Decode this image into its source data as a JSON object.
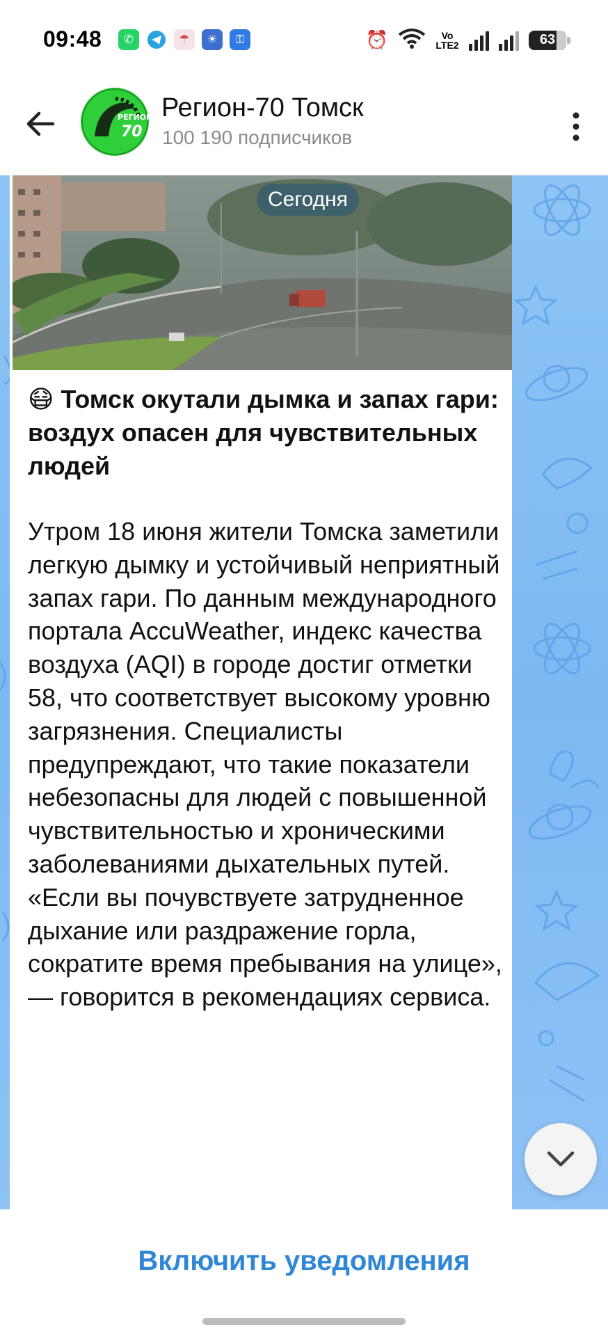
{
  "status_bar": {
    "time": "09:48",
    "app_icons": [
      "whatsapp-icon",
      "telegram-icon",
      "umbrella-icon",
      "weather-icon",
      "key-icon"
    ],
    "network": "Vo LTE2",
    "battery": "63"
  },
  "header": {
    "channel_name": "Регион-70 Томск",
    "subscribers": "100 190 подписчиков",
    "avatar_text_top": "РЕГИОН",
    "avatar_text_bottom": "70"
  },
  "chat": {
    "date_label": "Сегодня",
    "post": {
      "emoji": "😷",
      "title": "Томск окутали дымка и запах гари: воздух опасен для чувствительных людей",
      "body": "Утром 18 июня жители Томска заметили легкую дымку и устойчивый неприятный запах гари. По данным международного портала AccuWeather, индекс качества воздуха (AQI) в городе достиг отметки 58, что соответствует высокому уровню загрязнения. Специалисты предупреждают, что такие показатели небезопасны для людей с повышенной чувствительностью и хроническими заболеваниями дыхательных путей. «Если вы почувствуете затрудненное дыхание или раздражение горла, сократите время пребывания на улице», — говорится в рекомендациях сервиса."
    }
  },
  "bottom": {
    "notify_label": "Включить уведомления"
  },
  "colors": {
    "accent": "#2f86d7",
    "avatar_green": "#2fcf3a",
    "wallpaper": "#8ec5f5"
  }
}
